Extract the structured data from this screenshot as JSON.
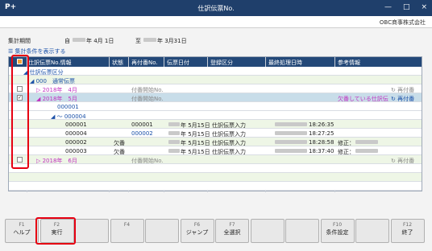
{
  "window": {
    "title": "仕訳伝票No.",
    "app_icon": "P+",
    "controls": [
      "—",
      "□",
      "×"
    ]
  },
  "company": "OBC商事株式会社",
  "period": {
    "label": "集計期間",
    "from_prefix": "自",
    "from_month_day": "年 4月 1日",
    "to_prefix": "至",
    "to_month_day": "年 3月31日"
  },
  "show_conditions": "集計条件を表示する",
  "grid": {
    "headers": [
      "仕訳伝票No.情報",
      "状態",
      "再付番No.",
      "伝票日付",
      "登録区分",
      "最終処理日時",
      "参考情報"
    ],
    "rows": [
      {
        "cls": "w",
        "indent": 18,
        "label": "◢ 仕訳伝票区分",
        "label_cls": "blue"
      },
      {
        "cls": "g",
        "indent": 26,
        "label": "◢ 000　通常伝票",
        "label_cls": "blue"
      },
      {
        "cls": "w",
        "cb": "",
        "indent": 34,
        "label": "▷ 2018年　4月",
        "label_cls": "mag",
        "renum": "付番開始No.",
        "renum_cls": "gray",
        "action": "↻ 再付番"
      },
      {
        "cls": "sel",
        "cb": "✓",
        "indent": 34,
        "label": "◢ 2018年　5月",
        "label_cls": "mag",
        "renum": "付番開始No.",
        "renum_cls": "gray",
        "info": "欠番している仕訳伝",
        "info_cls": "mag",
        "action": "↻ 再付番"
      },
      {
        "cls": "w",
        "indent": 60,
        "label": "000001",
        "label_cls": "blue"
      },
      {
        "cls": "w",
        "indent": 52,
        "label": "◢ 〜 000004",
        "label_cls": "blue"
      },
      {
        "cls": "g",
        "indent": 70,
        "label": "000001",
        "renum": "000001",
        "date": "年 5月15日",
        "reg": "仕訳伝票入力",
        "time": "18:26:35"
      },
      {
        "cls": "w",
        "indent": 70,
        "label": "000004",
        "renum": "000002",
        "renum_cls": "blue",
        "date": "年 5月15日",
        "reg": "仕訳伝票入力",
        "time": "18:27:25"
      },
      {
        "cls": "g",
        "indent": 70,
        "label": "000002",
        "status": "欠番",
        "date": "年 5月15日",
        "reg": "仕訳伝票入力",
        "time": "18:28:58",
        "info": "修正："
      },
      {
        "cls": "w",
        "indent": 70,
        "label": "000003",
        "status": "欠番",
        "date": "年 5月15日",
        "reg": "仕訳伝票入力",
        "time": "18:37:40",
        "info": "修正："
      },
      {
        "cls": "g",
        "cb": "",
        "indent": 34,
        "label": "▷ 2018年　6月",
        "label_cls": "mag",
        "renum": "付番開始No.",
        "renum_cls": "gray",
        "action": "↻ 再付番"
      }
    ]
  },
  "fkeys": [
    {
      "n": "F1",
      "l": "ヘルプ"
    },
    {
      "n": "F2",
      "l": "実行"
    },
    {
      "n": "",
      "l": ""
    },
    {
      "n": "F4",
      "l": ""
    },
    {
      "n": "",
      "l": ""
    },
    {
      "n": "F6",
      "l": "ジャンプ"
    },
    {
      "n": "F7",
      "l": "全選択"
    },
    {
      "n": "",
      "l": ""
    },
    {
      "n": "",
      "l": ""
    },
    {
      "n": "F10",
      "l": "条件設定"
    },
    {
      "n": "",
      "l": ""
    },
    {
      "n": "F12",
      "l": "終了"
    }
  ]
}
